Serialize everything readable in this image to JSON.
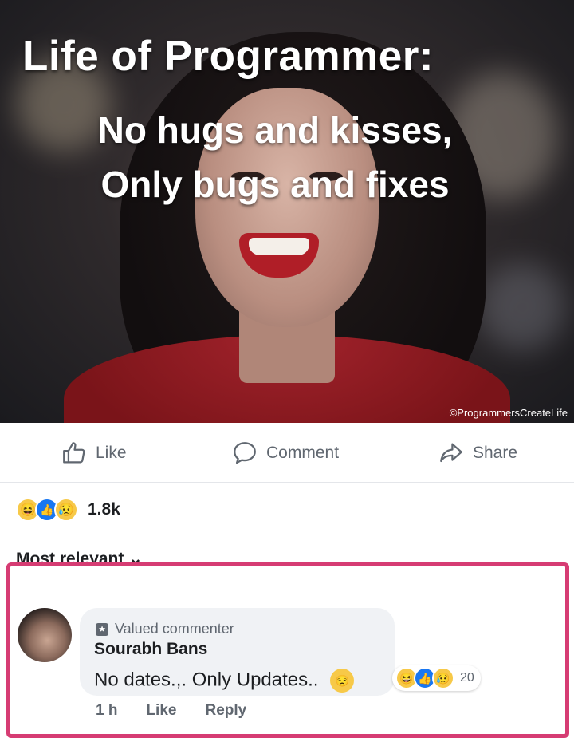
{
  "post": {
    "meme_title": "Life of Programmer:",
    "meme_line1": "No hugs and kisses,",
    "meme_line2": "Only bugs and fixes",
    "watermark": "©ProgrammersCreateLife"
  },
  "actions": {
    "like": "Like",
    "comment": "Comment",
    "share": "Share"
  },
  "reactions": {
    "icons": [
      "haha-icon",
      "like-icon",
      "sad-icon"
    ],
    "count": "1.8k"
  },
  "comments_sort": "Most relevant ⌄",
  "highlight_color": "#d63c73",
  "comment": {
    "badge": "Valued commenter",
    "author": "Sourabh Bans",
    "text": "No dates.,. Only Updates..",
    "reaction_count": "20",
    "time": "1 h",
    "like": "Like",
    "reply": "Reply"
  }
}
